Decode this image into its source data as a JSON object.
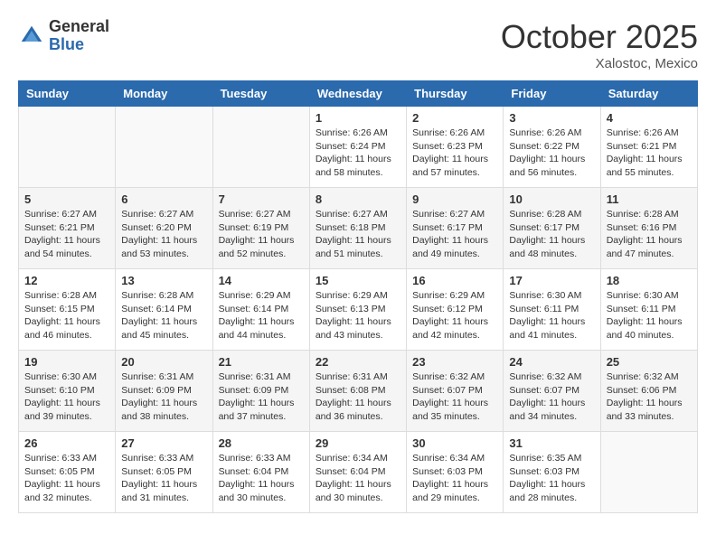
{
  "header": {
    "logo_general": "General",
    "logo_blue": "Blue",
    "month_title": "October 2025",
    "location": "Xalostoc, Mexico"
  },
  "weekdays": [
    "Sunday",
    "Monday",
    "Tuesday",
    "Wednesday",
    "Thursday",
    "Friday",
    "Saturday"
  ],
  "weeks": [
    [
      {
        "day": "",
        "sunrise": "",
        "sunset": "",
        "daylight": ""
      },
      {
        "day": "",
        "sunrise": "",
        "sunset": "",
        "daylight": ""
      },
      {
        "day": "",
        "sunrise": "",
        "sunset": "",
        "daylight": ""
      },
      {
        "day": "1",
        "sunrise": "Sunrise: 6:26 AM",
        "sunset": "Sunset: 6:24 PM",
        "daylight": "Daylight: 11 hours and 58 minutes."
      },
      {
        "day": "2",
        "sunrise": "Sunrise: 6:26 AM",
        "sunset": "Sunset: 6:23 PM",
        "daylight": "Daylight: 11 hours and 57 minutes."
      },
      {
        "day": "3",
        "sunrise": "Sunrise: 6:26 AM",
        "sunset": "Sunset: 6:22 PM",
        "daylight": "Daylight: 11 hours and 56 minutes."
      },
      {
        "day": "4",
        "sunrise": "Sunrise: 6:26 AM",
        "sunset": "Sunset: 6:21 PM",
        "daylight": "Daylight: 11 hours and 55 minutes."
      }
    ],
    [
      {
        "day": "5",
        "sunrise": "Sunrise: 6:27 AM",
        "sunset": "Sunset: 6:21 PM",
        "daylight": "Daylight: 11 hours and 54 minutes."
      },
      {
        "day": "6",
        "sunrise": "Sunrise: 6:27 AM",
        "sunset": "Sunset: 6:20 PM",
        "daylight": "Daylight: 11 hours and 53 minutes."
      },
      {
        "day": "7",
        "sunrise": "Sunrise: 6:27 AM",
        "sunset": "Sunset: 6:19 PM",
        "daylight": "Daylight: 11 hours and 52 minutes."
      },
      {
        "day": "8",
        "sunrise": "Sunrise: 6:27 AM",
        "sunset": "Sunset: 6:18 PM",
        "daylight": "Daylight: 11 hours and 51 minutes."
      },
      {
        "day": "9",
        "sunrise": "Sunrise: 6:27 AM",
        "sunset": "Sunset: 6:17 PM",
        "daylight": "Daylight: 11 hours and 49 minutes."
      },
      {
        "day": "10",
        "sunrise": "Sunrise: 6:28 AM",
        "sunset": "Sunset: 6:17 PM",
        "daylight": "Daylight: 11 hours and 48 minutes."
      },
      {
        "day": "11",
        "sunrise": "Sunrise: 6:28 AM",
        "sunset": "Sunset: 6:16 PM",
        "daylight": "Daylight: 11 hours and 47 minutes."
      }
    ],
    [
      {
        "day": "12",
        "sunrise": "Sunrise: 6:28 AM",
        "sunset": "Sunset: 6:15 PM",
        "daylight": "Daylight: 11 hours and 46 minutes."
      },
      {
        "day": "13",
        "sunrise": "Sunrise: 6:28 AM",
        "sunset": "Sunset: 6:14 PM",
        "daylight": "Daylight: 11 hours and 45 minutes."
      },
      {
        "day": "14",
        "sunrise": "Sunrise: 6:29 AM",
        "sunset": "Sunset: 6:14 PM",
        "daylight": "Daylight: 11 hours and 44 minutes."
      },
      {
        "day": "15",
        "sunrise": "Sunrise: 6:29 AM",
        "sunset": "Sunset: 6:13 PM",
        "daylight": "Daylight: 11 hours and 43 minutes."
      },
      {
        "day": "16",
        "sunrise": "Sunrise: 6:29 AM",
        "sunset": "Sunset: 6:12 PM",
        "daylight": "Daylight: 11 hours and 42 minutes."
      },
      {
        "day": "17",
        "sunrise": "Sunrise: 6:30 AM",
        "sunset": "Sunset: 6:11 PM",
        "daylight": "Daylight: 11 hours and 41 minutes."
      },
      {
        "day": "18",
        "sunrise": "Sunrise: 6:30 AM",
        "sunset": "Sunset: 6:11 PM",
        "daylight": "Daylight: 11 hours and 40 minutes."
      }
    ],
    [
      {
        "day": "19",
        "sunrise": "Sunrise: 6:30 AM",
        "sunset": "Sunset: 6:10 PM",
        "daylight": "Daylight: 11 hours and 39 minutes."
      },
      {
        "day": "20",
        "sunrise": "Sunrise: 6:31 AM",
        "sunset": "Sunset: 6:09 PM",
        "daylight": "Daylight: 11 hours and 38 minutes."
      },
      {
        "day": "21",
        "sunrise": "Sunrise: 6:31 AM",
        "sunset": "Sunset: 6:09 PM",
        "daylight": "Daylight: 11 hours and 37 minutes."
      },
      {
        "day": "22",
        "sunrise": "Sunrise: 6:31 AM",
        "sunset": "Sunset: 6:08 PM",
        "daylight": "Daylight: 11 hours and 36 minutes."
      },
      {
        "day": "23",
        "sunrise": "Sunrise: 6:32 AM",
        "sunset": "Sunset: 6:07 PM",
        "daylight": "Daylight: 11 hours and 35 minutes."
      },
      {
        "day": "24",
        "sunrise": "Sunrise: 6:32 AM",
        "sunset": "Sunset: 6:07 PM",
        "daylight": "Daylight: 11 hours and 34 minutes."
      },
      {
        "day": "25",
        "sunrise": "Sunrise: 6:32 AM",
        "sunset": "Sunset: 6:06 PM",
        "daylight": "Daylight: 11 hours and 33 minutes."
      }
    ],
    [
      {
        "day": "26",
        "sunrise": "Sunrise: 6:33 AM",
        "sunset": "Sunset: 6:05 PM",
        "daylight": "Daylight: 11 hours and 32 minutes."
      },
      {
        "day": "27",
        "sunrise": "Sunrise: 6:33 AM",
        "sunset": "Sunset: 6:05 PM",
        "daylight": "Daylight: 11 hours and 31 minutes."
      },
      {
        "day": "28",
        "sunrise": "Sunrise: 6:33 AM",
        "sunset": "Sunset: 6:04 PM",
        "daylight": "Daylight: 11 hours and 30 minutes."
      },
      {
        "day": "29",
        "sunrise": "Sunrise: 6:34 AM",
        "sunset": "Sunset: 6:04 PM",
        "daylight": "Daylight: 11 hours and 30 minutes."
      },
      {
        "day": "30",
        "sunrise": "Sunrise: 6:34 AM",
        "sunset": "Sunset: 6:03 PM",
        "daylight": "Daylight: 11 hours and 29 minutes."
      },
      {
        "day": "31",
        "sunrise": "Sunrise: 6:35 AM",
        "sunset": "Sunset: 6:03 PM",
        "daylight": "Daylight: 11 hours and 28 minutes."
      },
      {
        "day": "",
        "sunrise": "",
        "sunset": "",
        "daylight": ""
      }
    ]
  ]
}
